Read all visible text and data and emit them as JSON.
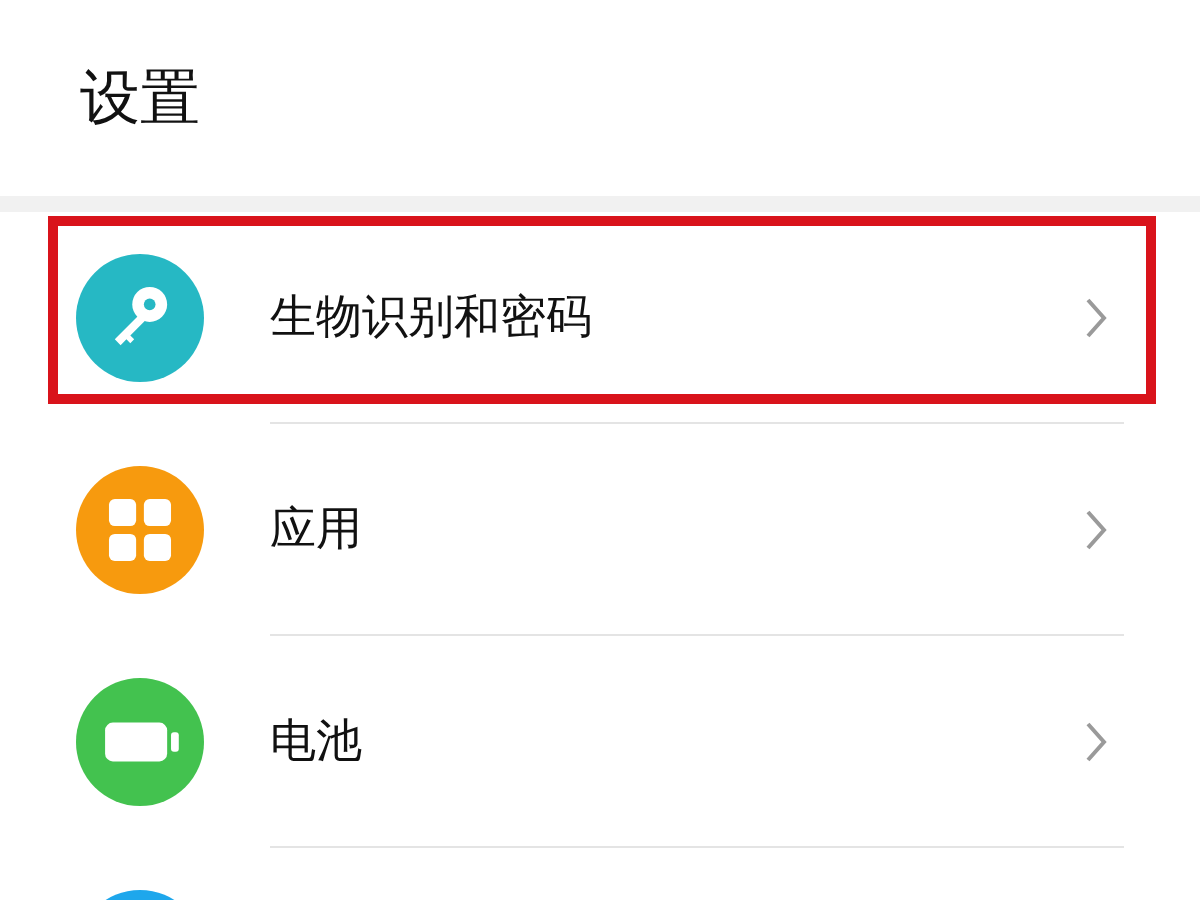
{
  "header": {
    "title": "设置"
  },
  "items": [
    {
      "kind": "key",
      "color": "#26b8c4",
      "label": "生物识别和密码",
      "highlighted": true
    },
    {
      "kind": "grid",
      "color": "#f79a0e",
      "label": "应用",
      "highlighted": false
    },
    {
      "kind": "battery",
      "color": "#43c24f",
      "label": "电池",
      "highlighted": false
    },
    {
      "kind": "partial",
      "color": "#1ea7ec"
    }
  ]
}
